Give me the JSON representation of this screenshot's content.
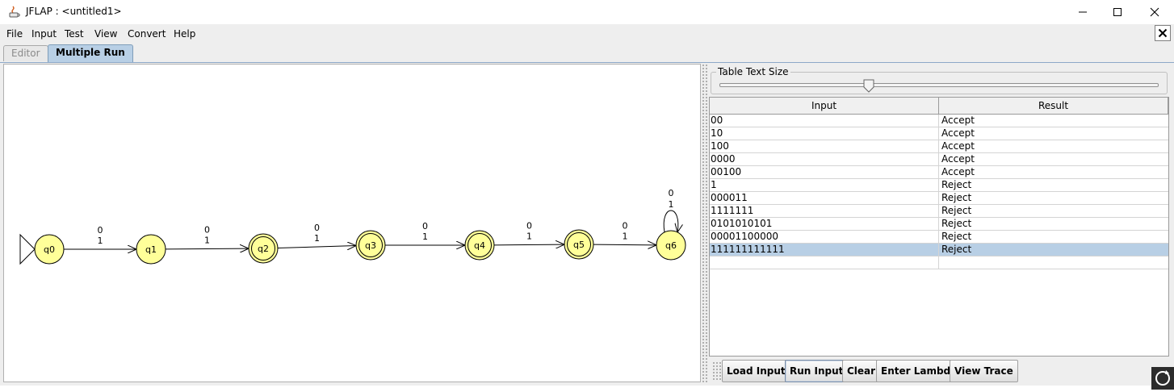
{
  "window": {
    "title": "JFLAP : <untitled1>",
    "controls": {
      "minimize": "minimize-icon",
      "maximize": "maximize-icon",
      "close": "close-icon"
    }
  },
  "menu": [
    "File",
    "Input",
    "Test",
    "View",
    "Convert",
    "Help"
  ],
  "tabs": [
    {
      "label": "Editor",
      "selected": false
    },
    {
      "label": "Multiple Run",
      "selected": true
    }
  ],
  "automaton": {
    "states": [
      {
        "name": "q0",
        "initial": true,
        "final": false
      },
      {
        "name": "q1",
        "initial": false,
        "final": false
      },
      {
        "name": "q2",
        "initial": false,
        "final": true
      },
      {
        "name": "q3",
        "initial": false,
        "final": true
      },
      {
        "name": "q4",
        "initial": false,
        "final": true
      },
      {
        "name": "q5",
        "initial": false,
        "final": true
      },
      {
        "name": "q6",
        "initial": false,
        "final": false
      }
    ],
    "transitions": [
      {
        "from": "q0",
        "to": "q1",
        "labels": [
          "0",
          "1"
        ]
      },
      {
        "from": "q1",
        "to": "q2",
        "labels": [
          "0",
          "1"
        ]
      },
      {
        "from": "q2",
        "to": "q3",
        "labels": [
          "0",
          "1"
        ]
      },
      {
        "from": "q3",
        "to": "q4",
        "labels": [
          "0",
          "1"
        ]
      },
      {
        "from": "q4",
        "to": "q5",
        "labels": [
          "0",
          "1"
        ]
      },
      {
        "from": "q5",
        "to": "q6",
        "labels": [
          "0",
          "1"
        ]
      },
      {
        "from": "q6",
        "to": "q6",
        "labels": [
          "0",
          "1"
        ]
      }
    ],
    "colors": {
      "state_fill": "#ffff99",
      "state_stroke": "#000000"
    }
  },
  "table_text_size": {
    "label": "Table Text Size",
    "level": 0.34
  },
  "results_table": {
    "columns": [
      "Input",
      "Result"
    ],
    "rows": [
      {
        "input": "00",
        "result": "Accept"
      },
      {
        "input": "10",
        "result": "Accept"
      },
      {
        "input": "100",
        "result": "Accept"
      },
      {
        "input": "0000",
        "result": "Accept"
      },
      {
        "input": "00100",
        "result": "Accept"
      },
      {
        "input": "1",
        "result": "Reject"
      },
      {
        "input": "000011",
        "result": "Reject"
      },
      {
        "input": "1111111",
        "result": "Reject"
      },
      {
        "input": "0101010101",
        "result": "Reject"
      },
      {
        "input": "00001100000",
        "result": "Reject"
      },
      {
        "input": "111111111111",
        "result": "Reject",
        "selected": true
      },
      {
        "input": "",
        "result": ""
      }
    ],
    "selection_color": "#b8cfe5"
  },
  "buttons": [
    "Load Inputs",
    "Run Inputs",
    "Clear",
    "Enter Lambda",
    "View Trace"
  ]
}
